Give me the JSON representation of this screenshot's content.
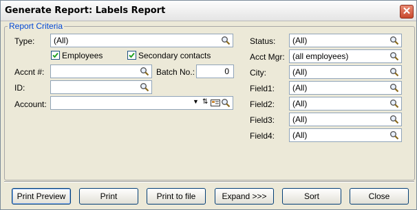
{
  "window": {
    "title": "Generate Report:  Labels Report"
  },
  "criteria": {
    "legend": "Report Criteria",
    "type": {
      "label": "Type:",
      "value": "(All)"
    },
    "employees": {
      "label": "Employees",
      "checked": true
    },
    "secondary_contacts": {
      "label": "Secondary contacts",
      "checked": true
    },
    "accnt": {
      "label": "Accnt #:",
      "value": ""
    },
    "batch": {
      "label": "Batch No.:",
      "value": "0"
    },
    "id": {
      "label": "ID:",
      "value": ""
    },
    "account": {
      "label": "Account:",
      "value": ""
    },
    "status": {
      "label": "Status:",
      "value": "(All)"
    },
    "acct_mgr": {
      "label": "Acct Mgr:",
      "value": "(all employees)"
    },
    "city": {
      "label": "City:",
      "value": "(All)"
    },
    "field1": {
      "label": "Field1:",
      "value": "(All)"
    },
    "field2": {
      "label": "Field2:",
      "value": "(All)"
    },
    "field3": {
      "label": "Field3:",
      "value": "(All)"
    },
    "field4": {
      "label": "Field4:",
      "value": "(All)"
    }
  },
  "buttons": {
    "print_preview": "Print Preview",
    "print": "Print",
    "print_to_file": "Print to file",
    "expand": "Expand >>>",
    "sort": "Sort",
    "close": "Close"
  },
  "icons": {
    "lookup": "magnifier-icon",
    "checkbox": "checkmark-icon",
    "close": "close-icon",
    "dropdown": "dropdown-arrow-icon",
    "address_card": "address-card-icon"
  },
  "colors": {
    "legend_text": "#0046d5",
    "close_button": "#c8492d",
    "button_border": "#003c74"
  }
}
